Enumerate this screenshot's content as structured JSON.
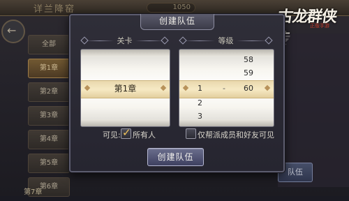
{
  "background": {
    "title": "详兰降窑",
    "resource": "1050",
    "back_glyph": "←",
    "stage_list": [
      "全部",
      "第1章",
      "第2章",
      "第3章",
      "第4章",
      "第5章",
      "第6章"
    ],
    "stage_list_7": "第7章",
    "right_button": "队伍",
    "logo_text": "古龙群侠传",
    "logo_sub": "正版手游"
  },
  "dialog": {
    "title": "创建队伍",
    "stage_header": "关卡",
    "level_header": "等级",
    "selected_stage": "第1章",
    "levels_above": [
      "58",
      "59"
    ],
    "level_max_selected": "60",
    "level_min_selected": "1",
    "levels_below": [
      "2",
      "3"
    ],
    "range_separator": "-",
    "visibility_label": "可见:",
    "option_everyone": "所有人",
    "option_guild_friends": "仅帮派成员和好友可见",
    "create_button": "创建队伍"
  },
  "colors": {
    "accent_gold": "#f0c45c",
    "selected_band": "#f6e9c4",
    "button": "#4f5275"
  }
}
